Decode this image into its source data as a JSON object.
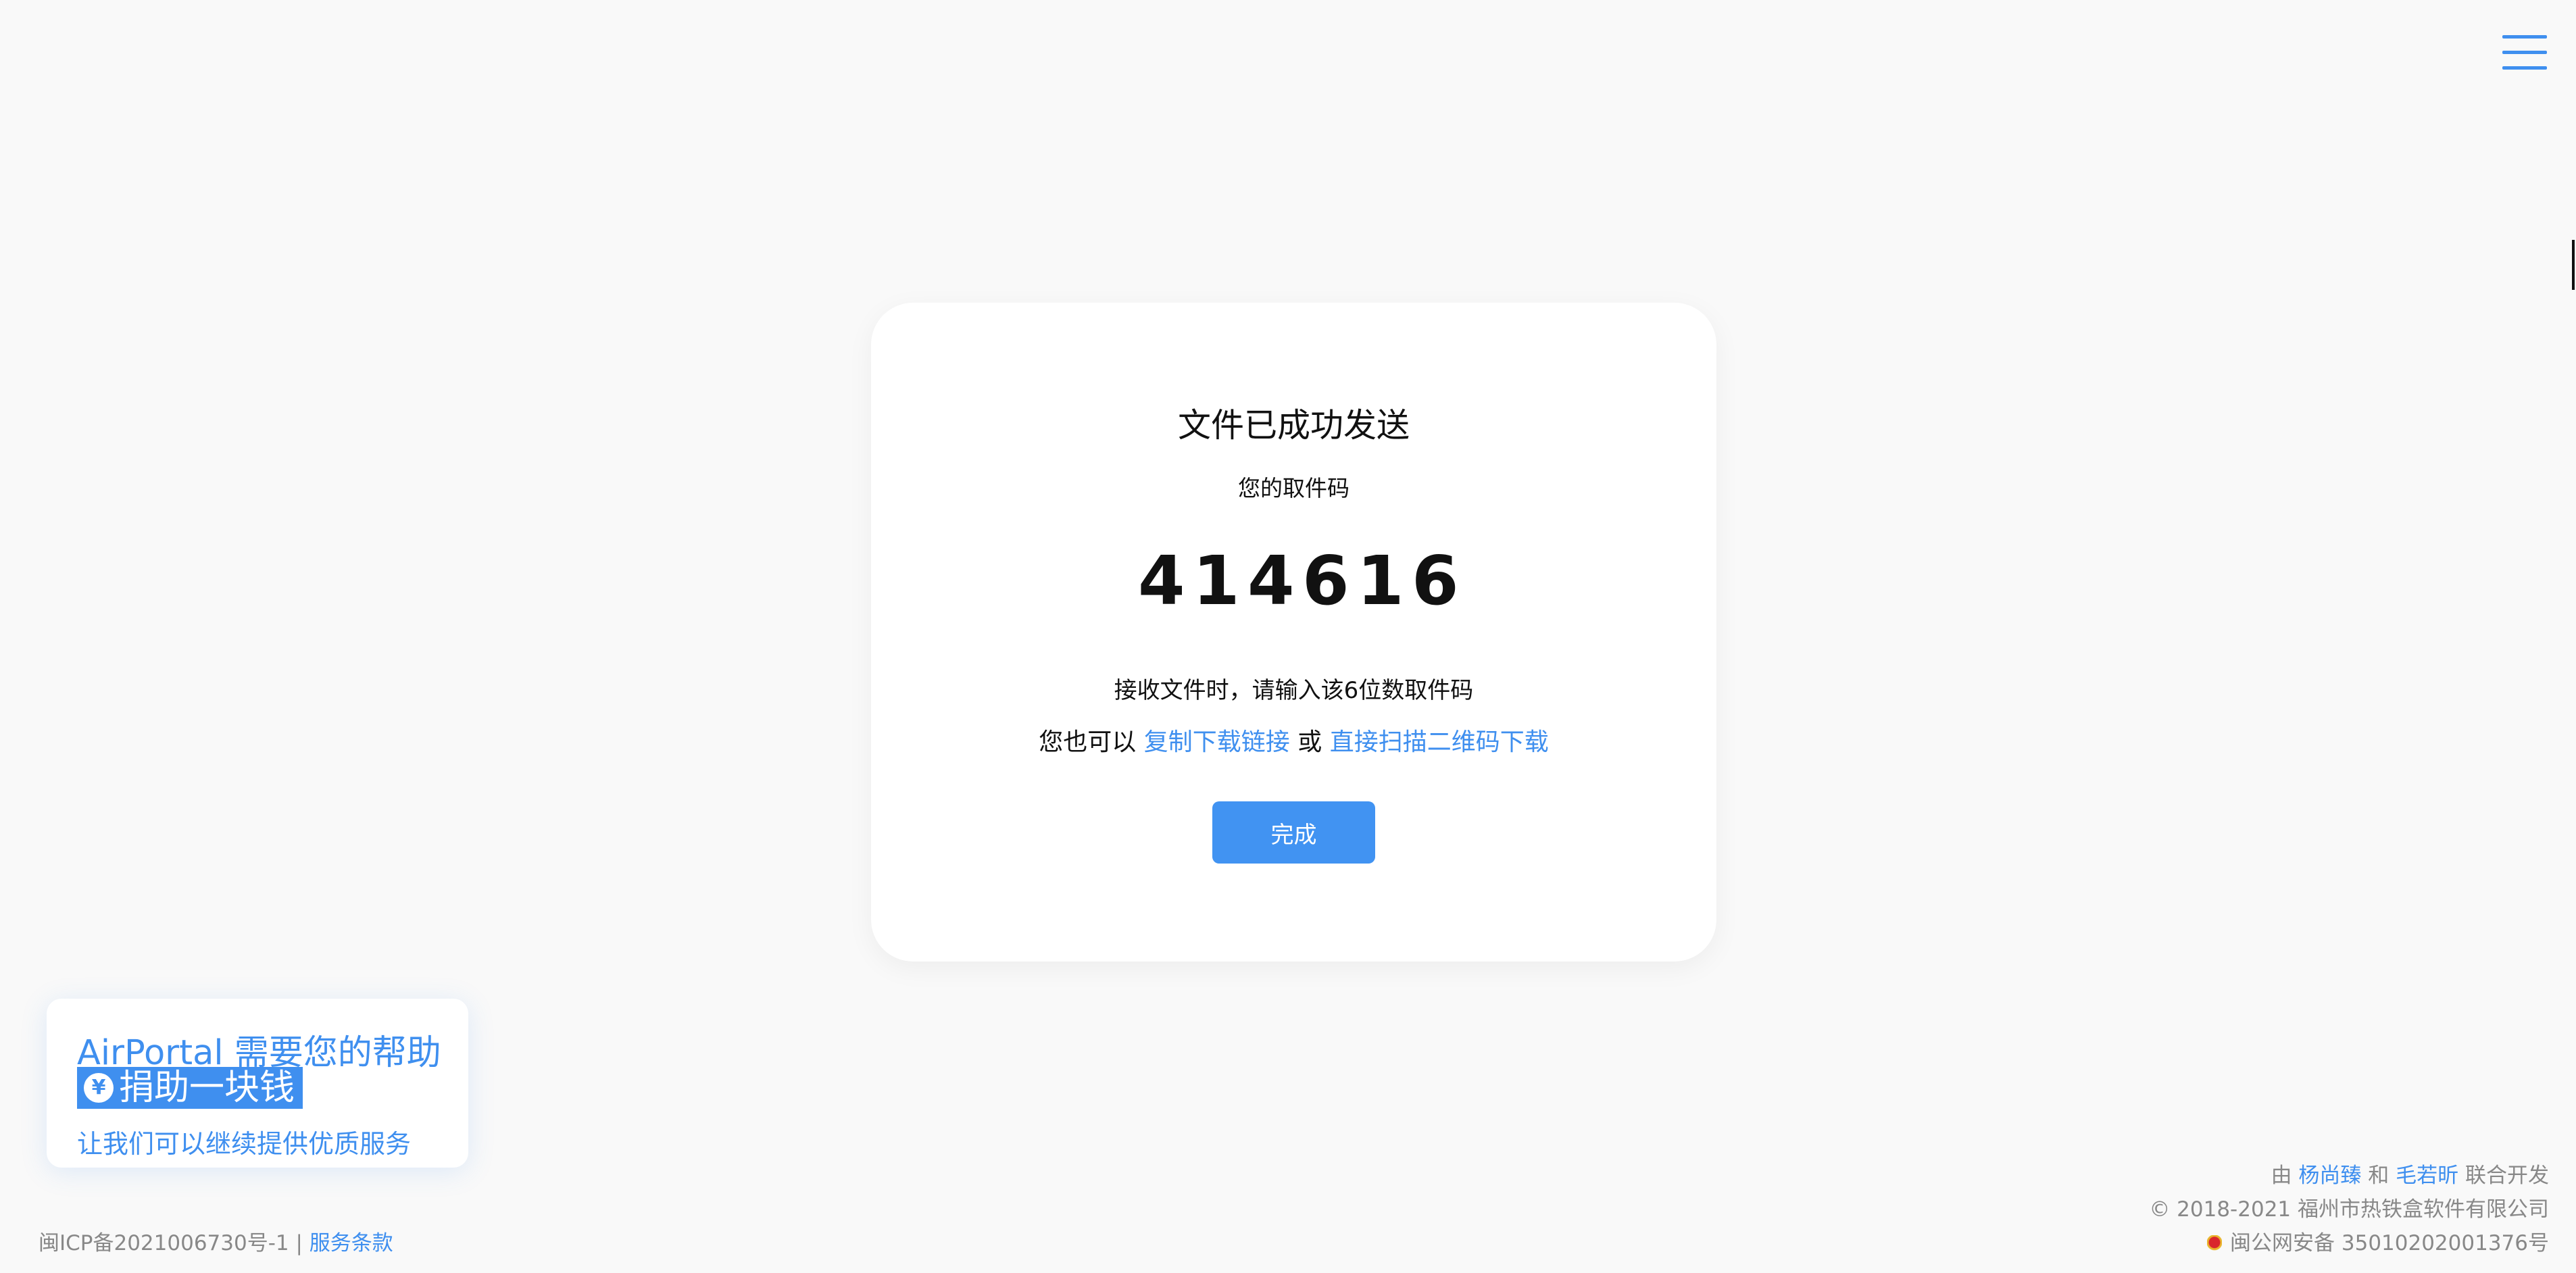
{
  "header": {
    "menu_icon": "hamburger-menu-icon"
  },
  "card": {
    "title": "文件已成功发送",
    "subtitle": "您的取件码",
    "code_digits": [
      "4",
      "1",
      "4",
      "6",
      "1",
      "6"
    ],
    "hint": "接收文件时，请输入该6位数取件码",
    "alt_prefix": "您也可以",
    "copy_link_label": "复制下载链接",
    "alt_or": "或",
    "qr_link_label": "直接扫描二维码下载",
    "done_label": "完成"
  },
  "donate": {
    "title": "AirPortal 需要您的帮助",
    "button_label": "捐助一块钱",
    "button_icon": "yuan-icon",
    "subtitle": "让我们可以继续提供优质服务"
  },
  "footer": {
    "icp_text": "闽ICP备2021006730号-1",
    "separator": "|",
    "terms_label": "服务条款",
    "credits_by": "由",
    "dev1": "杨尚臻",
    "credits_and": "和",
    "dev2": "毛若昕",
    "credits_suffix": "联合开发",
    "copyright": "© 2018-2021 福州市热铁盒软件有限公司",
    "police_icon": "police-badge-icon",
    "police_text": "闽公网安备 35010202001376号"
  },
  "colors": {
    "accent": "#3f8fef",
    "button": "#4193f2",
    "background": "#f9f9f9"
  }
}
